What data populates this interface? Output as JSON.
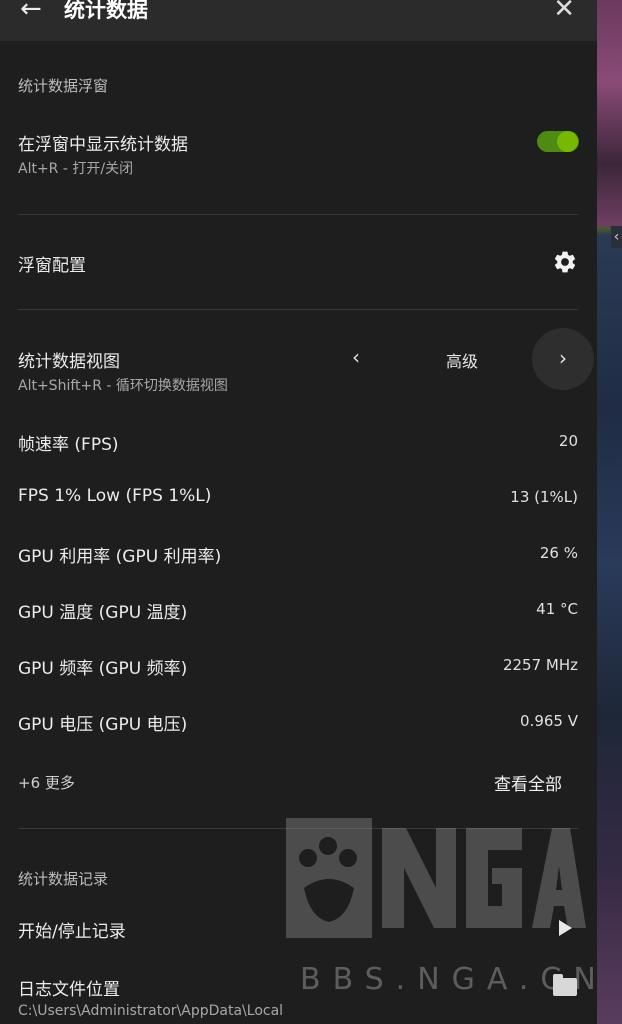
{
  "header": {
    "back_icon": "arrow-left-icon",
    "title": "统计数据",
    "close_icon": "close-icon"
  },
  "overlay_section": {
    "label": "统计数据浮窗",
    "show_title": "在浮窗中显示统计数据",
    "show_shortcut": "Alt+R - 打开/关闭",
    "toggle_on": true
  },
  "config": {
    "title": "浮窗配置",
    "icon": "gear-icon"
  },
  "view": {
    "title": "统计数据视图",
    "shortcut": "Alt+Shift+R - 循环切换数据视图",
    "selected": "高级"
  },
  "stats": [
    {
      "label": "帧速率 (FPS)",
      "value": "20"
    },
    {
      "label": "FPS 1% Low (FPS 1%L)",
      "value": "13 (1%L)"
    },
    {
      "label": "GPU 利用率 (GPU 利用率)",
      "value": "26 %"
    },
    {
      "label": "GPU 温度 (GPU 温度)",
      "value": "41 °C"
    },
    {
      "label": "GPU 频率 (GPU 频率)",
      "value": "2257 MHz"
    },
    {
      "label": "GPU 电压 (GPU 电压)",
      "value": "0.965 V"
    }
  ],
  "more": {
    "count_label": "+6 更多",
    "view_all": "查看全部"
  },
  "logging": {
    "label": "统计数据记录",
    "start_stop": "开始/停止记录",
    "log_location_title": "日志文件位置",
    "log_path": "C:\\Users\\Administrator\\AppData\\Local"
  },
  "watermark": {
    "logo": "NGA",
    "text": "BBS.NGA.CN"
  },
  "colors": {
    "accent": "#76b900",
    "panel_bg": "#1e1e1e",
    "header_bg": "#2b2b2b"
  }
}
